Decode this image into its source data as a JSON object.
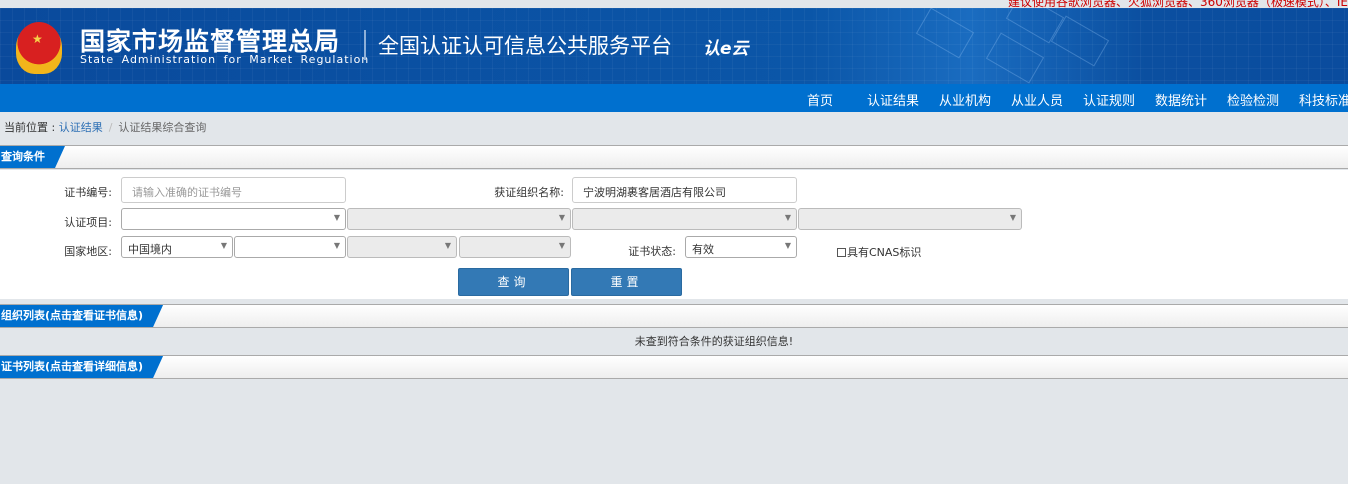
{
  "top_notice": "建议使用谷歌浏览器、火狐浏览器、360浏览器（极速模式）、IE",
  "header": {
    "agency_cn": "国家市场监督管理总局",
    "agency_en": "State Administration  for  Market Regulation",
    "platform": "全国认证认可信息公共服务平台",
    "logo_text": "认e云"
  },
  "nav": [
    "首页",
    "认证结果",
    "从业机构",
    "从业人员",
    "认证规则",
    "数据统计",
    "检验检测",
    "科技标准"
  ],
  "breadcrumb": {
    "prefix": "当前位置 :",
    "link": "认证结果",
    "current": "认证结果综合查询"
  },
  "query": {
    "title": "查询条件",
    "cert_no_label": "证书编号:",
    "cert_no_placeholder": "请输入准确的证书编号",
    "org_label": "获证组织名称:",
    "org_value": "宁波明湖裹客居酒店有限公司",
    "project_label": "认证项目:",
    "region_label": "国家地区:",
    "region_value": "中国境内",
    "status_label": "证书状态:",
    "status_value": "有效",
    "cnas_label": "具有CNAS标识",
    "search_button": "查询",
    "reset_button": "重置"
  },
  "org_list": {
    "title": "组织列表(点击查看证书信息)",
    "empty_message": "未查到符合条件的获证组织信息!"
  },
  "cert_list": {
    "title": "证书列表(点击查看详细信息)"
  },
  "colors": {
    "header": "#0a4c9e",
    "nav": "#0070cf",
    "button": "#3379b5",
    "notice": "#cc0000"
  }
}
